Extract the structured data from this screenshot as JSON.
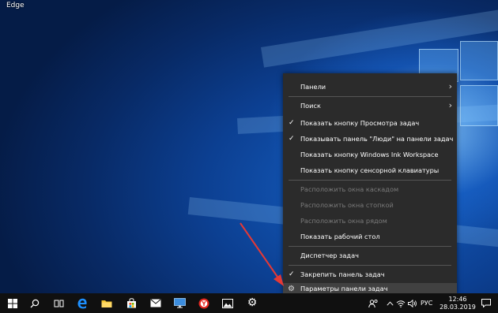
{
  "desktop": {
    "icon_label": "Edge"
  },
  "context_menu": {
    "items": [
      {
        "label": "Панели",
        "submenu": true,
        "checked": false,
        "disabled": false
      },
      {
        "label": "Поиск",
        "submenu": true,
        "checked": false,
        "disabled": false
      },
      {
        "label": "Показать кнопку Просмотра задач",
        "checked": true,
        "disabled": false
      },
      {
        "label": "Показывать панель \"Люди\" на панели задач",
        "checked": true,
        "disabled": false
      },
      {
        "label": "Показать кнопку Windows Ink Workspace",
        "checked": false,
        "disabled": false
      },
      {
        "label": "Показать кнопку сенсорной клавиатуры",
        "checked": false,
        "disabled": false
      },
      {
        "label": "Расположить окна каскадом",
        "checked": false,
        "disabled": true
      },
      {
        "label": "Расположить окна стопкой",
        "checked": false,
        "disabled": true
      },
      {
        "label": "Расположить окна рядом",
        "checked": false,
        "disabled": true
      },
      {
        "label": "Показать рабочий стол",
        "checked": false,
        "disabled": false
      },
      {
        "label": "Диспетчер задач",
        "checked": false,
        "disabled": false
      },
      {
        "label": "Закрепить панель задач",
        "checked": true,
        "disabled": false
      },
      {
        "label": "Параметры панели задач",
        "checked": false,
        "disabled": false,
        "hovered": true
      }
    ]
  },
  "taskbar": {
    "language": "РУС",
    "time": "12:46",
    "date": "28.03.2019"
  },
  "colors": {
    "menu_bg": "#2b2b2b",
    "menu_hover": "#414141",
    "taskbar_bg": "#101010",
    "arrow": "#e53935",
    "edge_blue": "#1e90ff",
    "yandex_red": "#e52620"
  }
}
